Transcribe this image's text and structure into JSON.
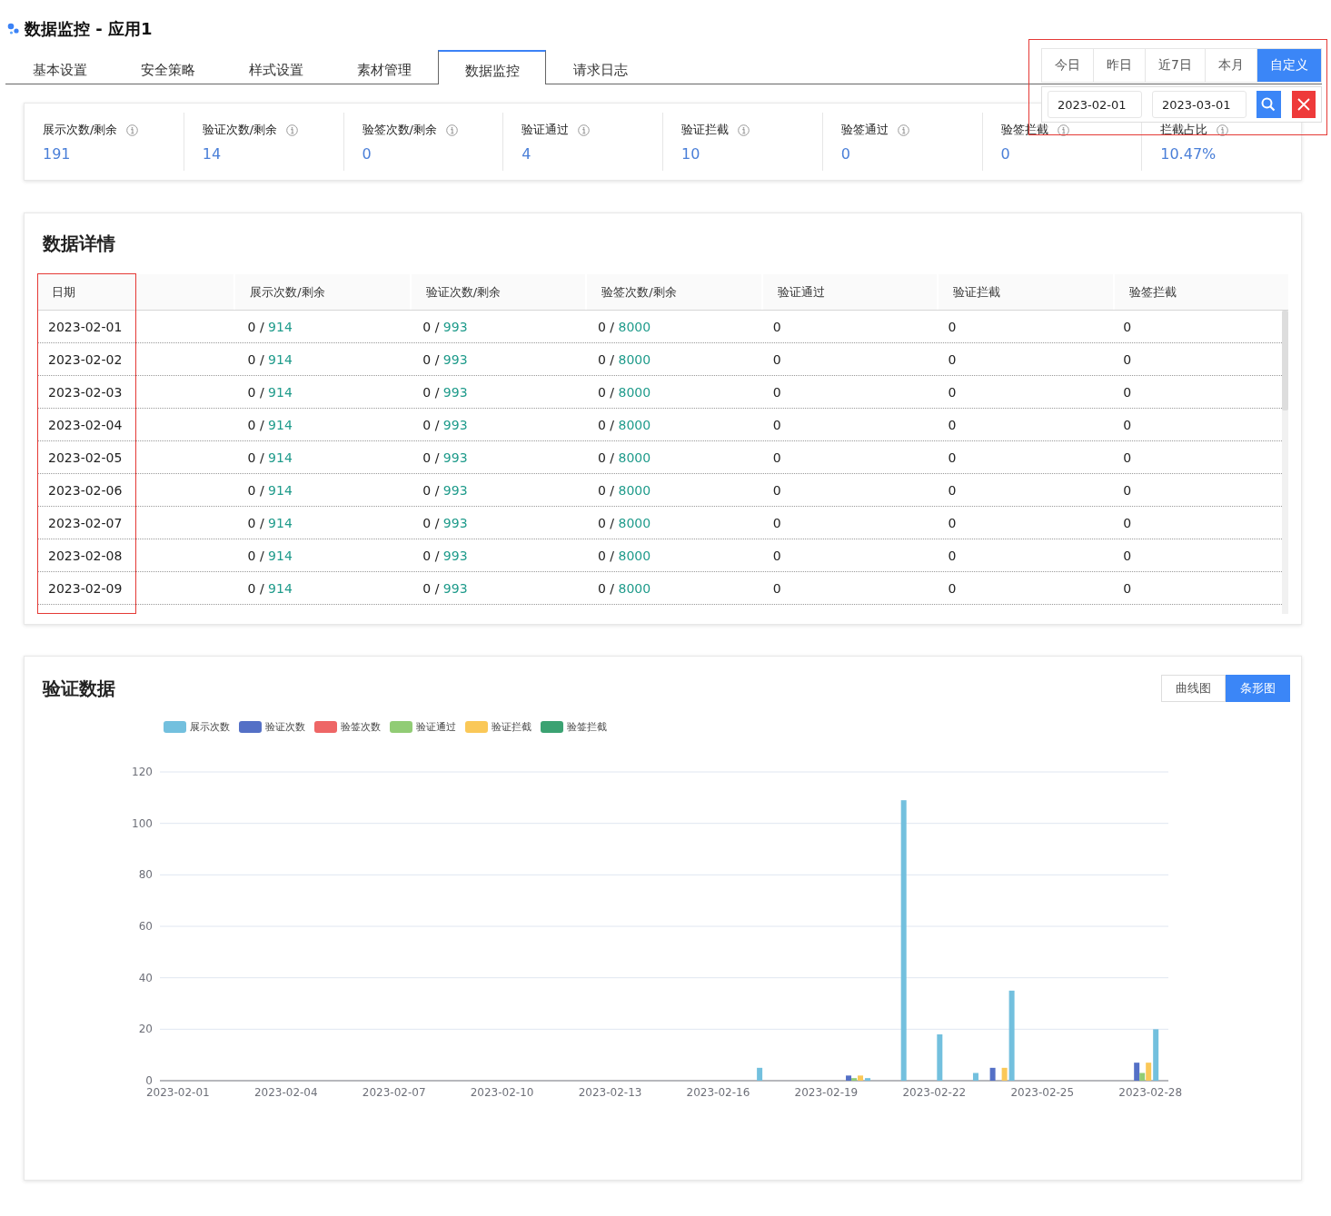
{
  "page_title": "数据监控 - 应用1",
  "tabs": [
    {
      "label": "基本设置",
      "selected": false
    },
    {
      "label": "安全策略",
      "selected": false
    },
    {
      "label": "样式设置",
      "selected": false
    },
    {
      "label": "素材管理",
      "selected": false
    },
    {
      "label": "数据监控",
      "selected": true
    },
    {
      "label": "请求日志",
      "selected": false
    }
  ],
  "date_range": {
    "presets": [
      {
        "label": "今日",
        "selected": false
      },
      {
        "label": "昨日",
        "selected": false
      },
      {
        "label": "近7日",
        "selected": false
      },
      {
        "label": "本月",
        "selected": false
      },
      {
        "label": "自定义",
        "selected": true
      }
    ],
    "start": "2023-02-01",
    "end": "2023-03-01"
  },
  "stats": [
    {
      "label": "展示次数/剩余",
      "value": "191"
    },
    {
      "label": "验证次数/剩余",
      "value": "14"
    },
    {
      "label": "验签次数/剩余",
      "value": "0"
    },
    {
      "label": "验证通过",
      "value": "4"
    },
    {
      "label": "验证拦截",
      "value": "10"
    },
    {
      "label": "验签通过",
      "value": "0"
    },
    {
      "label": "验签拦截",
      "value": "0"
    },
    {
      "label": "拦截占比",
      "value": "10.47%"
    }
  ],
  "details": {
    "title": "数据详情",
    "columns": [
      "日期",
      "展示次数/剩余",
      "验证次数/剩余",
      "验签次数/剩余",
      "验证通过",
      "验证拦截",
      "验签拦截"
    ],
    "rows": [
      {
        "date": "2023-02-01",
        "show": {
          "used": "0 /",
          "remaining": "914"
        },
        "verify": {
          "used": "0 /",
          "remaining": "993"
        },
        "sign": {
          "used": "0 /",
          "remaining": "8000"
        },
        "pass": "0",
        "block": "0",
        "sign_block": "0"
      },
      {
        "date": "2023-02-02",
        "show": {
          "used": "0 /",
          "remaining": "914"
        },
        "verify": {
          "used": "0 /",
          "remaining": "993"
        },
        "sign": {
          "used": "0 /",
          "remaining": "8000"
        },
        "pass": "0",
        "block": "0",
        "sign_block": "0"
      },
      {
        "date": "2023-02-03",
        "show": {
          "used": "0 /",
          "remaining": "914"
        },
        "verify": {
          "used": "0 /",
          "remaining": "993"
        },
        "sign": {
          "used": "0 /",
          "remaining": "8000"
        },
        "pass": "0",
        "block": "0",
        "sign_block": "0"
      },
      {
        "date": "2023-02-04",
        "show": {
          "used": "0 /",
          "remaining": "914"
        },
        "verify": {
          "used": "0 /",
          "remaining": "993"
        },
        "sign": {
          "used": "0 /",
          "remaining": "8000"
        },
        "pass": "0",
        "block": "0",
        "sign_block": "0"
      },
      {
        "date": "2023-02-05",
        "show": {
          "used": "0 /",
          "remaining": "914"
        },
        "verify": {
          "used": "0 /",
          "remaining": "993"
        },
        "sign": {
          "used": "0 /",
          "remaining": "8000"
        },
        "pass": "0",
        "block": "0",
        "sign_block": "0"
      },
      {
        "date": "2023-02-06",
        "show": {
          "used": "0 /",
          "remaining": "914"
        },
        "verify": {
          "used": "0 /",
          "remaining": "993"
        },
        "sign": {
          "used": "0 /",
          "remaining": "8000"
        },
        "pass": "0",
        "block": "0",
        "sign_block": "0"
      },
      {
        "date": "2023-02-07",
        "show": {
          "used": "0 /",
          "remaining": "914"
        },
        "verify": {
          "used": "0 /",
          "remaining": "993"
        },
        "sign": {
          "used": "0 /",
          "remaining": "8000"
        },
        "pass": "0",
        "block": "0",
        "sign_block": "0"
      },
      {
        "date": "2023-02-08",
        "show": {
          "used": "0 /",
          "remaining": "914"
        },
        "verify": {
          "used": "0 /",
          "remaining": "993"
        },
        "sign": {
          "used": "0 /",
          "remaining": "8000"
        },
        "pass": "0",
        "block": "0",
        "sign_block": "0"
      },
      {
        "date": "2023-02-09",
        "show": {
          "used": "0 /",
          "remaining": "914"
        },
        "verify": {
          "used": "0 /",
          "remaining": "993"
        },
        "sign": {
          "used": "0 /",
          "remaining": "8000"
        },
        "pass": "0",
        "block": "0",
        "sign_block": "0"
      }
    ]
  },
  "verification": {
    "title": "验证数据",
    "views": [
      {
        "label": "曲线图",
        "selected": false
      },
      {
        "label": "条形图",
        "selected": true
      }
    ],
    "chart_data": {
      "type": "bar",
      "categories": [
        "2023-02-01",
        null,
        null,
        "2023-02-04",
        null,
        null,
        "2023-02-07",
        null,
        null,
        "2023-02-10",
        null,
        null,
        "2023-02-13",
        null,
        null,
        "2023-02-16",
        null,
        null,
        "2023-02-19",
        null,
        null,
        "2023-02-22",
        null,
        null,
        "2023-02-25",
        null,
        null,
        "2023-02-28"
      ],
      "series": [
        {
          "name": "展示次数",
          "color": "#73c0de",
          "values": [
            0,
            0,
            0,
            0,
            0,
            0,
            0,
            0,
            0,
            0,
            0,
            0,
            0,
            0,
            0,
            0,
            5,
            0,
            0,
            1,
            109,
            18,
            3,
            35,
            0,
            0,
            0,
            20
          ]
        },
        {
          "name": "验证次数",
          "color": "#5470c6",
          "values": [
            0,
            0,
            0,
            0,
            0,
            0,
            0,
            0,
            0,
            0,
            0,
            0,
            0,
            0,
            0,
            0,
            0,
            0,
            0,
            2,
            0,
            0,
            0,
            5,
            0,
            0,
            0,
            7
          ]
        },
        {
          "name": "验签次数",
          "color": "#ee6666",
          "values": [
            0,
            0,
            0,
            0,
            0,
            0,
            0,
            0,
            0,
            0,
            0,
            0,
            0,
            0,
            0,
            0,
            0,
            0,
            0,
            0,
            0,
            0,
            0,
            0,
            0,
            0,
            0,
            0
          ]
        },
        {
          "name": "验证通过",
          "color": "#91cc75",
          "values": [
            0,
            0,
            0,
            0,
            0,
            0,
            0,
            0,
            0,
            0,
            0,
            0,
            0,
            0,
            0,
            0,
            0,
            0,
            0,
            1,
            0,
            0,
            0,
            0,
            0,
            0,
            0,
            3
          ]
        },
        {
          "name": "验证拦截",
          "color": "#fac858",
          "values": [
            0,
            0,
            0,
            0,
            0,
            0,
            0,
            0,
            0,
            0,
            0,
            0,
            0,
            0,
            0,
            0,
            0,
            0,
            0,
            2,
            0,
            0,
            0,
            5,
            0,
            0,
            0,
            7
          ]
        },
        {
          "name": "验签拦截",
          "color": "#3ba272",
          "values": [
            0,
            0,
            0,
            0,
            0,
            0,
            0,
            0,
            0,
            0,
            0,
            0,
            0,
            0,
            0,
            0,
            0,
            0,
            0,
            0,
            0,
            0,
            0,
            0,
            0,
            0,
            0,
            0
          ]
        }
      ],
      "ylim": [
        0,
        120
      ],
      "yticks": [
        0,
        20,
        40,
        60,
        80,
        100,
        120
      ],
      "grid": true
    }
  }
}
